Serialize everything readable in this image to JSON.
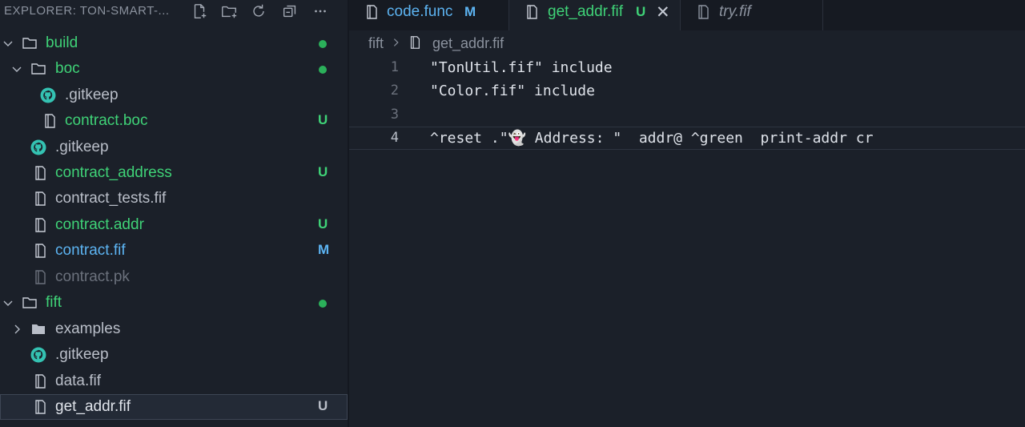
{
  "sidebar": {
    "title": "EXPLORER: TON-SMART-...",
    "actions": [
      {
        "name": "new-file-icon"
      },
      {
        "name": "new-folder-icon"
      },
      {
        "name": "refresh-icon"
      },
      {
        "name": "collapse-all-icon"
      },
      {
        "name": "more-icon"
      }
    ],
    "items": [
      {
        "label": "build",
        "kind": "folder-open",
        "color": "green",
        "status": "dot"
      },
      {
        "label": "boc",
        "kind": "folder-open",
        "color": "green",
        "status": "dot"
      },
      {
        "label": ".gitkeep",
        "kind": "github",
        "color": "grey",
        "status": ""
      },
      {
        "label": "contract.boc",
        "kind": "file",
        "color": "green",
        "status": "U"
      },
      {
        "label": ".gitkeep",
        "kind": "github",
        "color": "grey",
        "status": ""
      },
      {
        "label": "contract_address",
        "kind": "file",
        "color": "green",
        "status": "U"
      },
      {
        "label": "contract_tests.fif",
        "kind": "file",
        "color": "grey",
        "status": ""
      },
      {
        "label": "contract.addr",
        "kind": "file",
        "color": "green",
        "status": "U"
      },
      {
        "label": "contract.fif",
        "kind": "file",
        "color": "blue",
        "status": "M"
      },
      {
        "label": "contract.pk",
        "kind": "file",
        "color": "dim",
        "status": ""
      },
      {
        "label": "fift",
        "kind": "folder-open",
        "color": "green",
        "status": "dot"
      },
      {
        "label": "examples",
        "kind": "folder-closed",
        "color": "grey",
        "status": ""
      },
      {
        "label": ".gitkeep",
        "kind": "github",
        "color": "grey",
        "status": ""
      },
      {
        "label": "data.fif",
        "kind": "file",
        "color": "grey",
        "status": ""
      },
      {
        "label": "get_addr.fif",
        "kind": "file",
        "color": "grey",
        "status": "U",
        "selected": true
      }
    ]
  },
  "tabs": [
    {
      "label": "code.func",
      "badge": "M",
      "state": "modified"
    },
    {
      "label": "get_addr.fif",
      "badge": "U",
      "state": "active"
    },
    {
      "label": "try.fif",
      "badge": "",
      "state": "preview"
    }
  ],
  "breadcrumb": {
    "folder": "fift",
    "file": "get_addr.fif"
  },
  "editor": {
    "lines": [
      {
        "num": "1",
        "text": "\"TonUtil.fif\" include"
      },
      {
        "num": "2",
        "text": "\"Color.fif\" include"
      },
      {
        "num": "3",
        "text": ""
      },
      {
        "num": "4",
        "text": "^reset .\"👻 Address: \"  addr@ ^green  print-addr cr"
      }
    ],
    "current_line": 4
  },
  "colors": {
    "background": "#1b2029",
    "untracked": "#3fd277",
    "modified": "#5cb3f1"
  }
}
